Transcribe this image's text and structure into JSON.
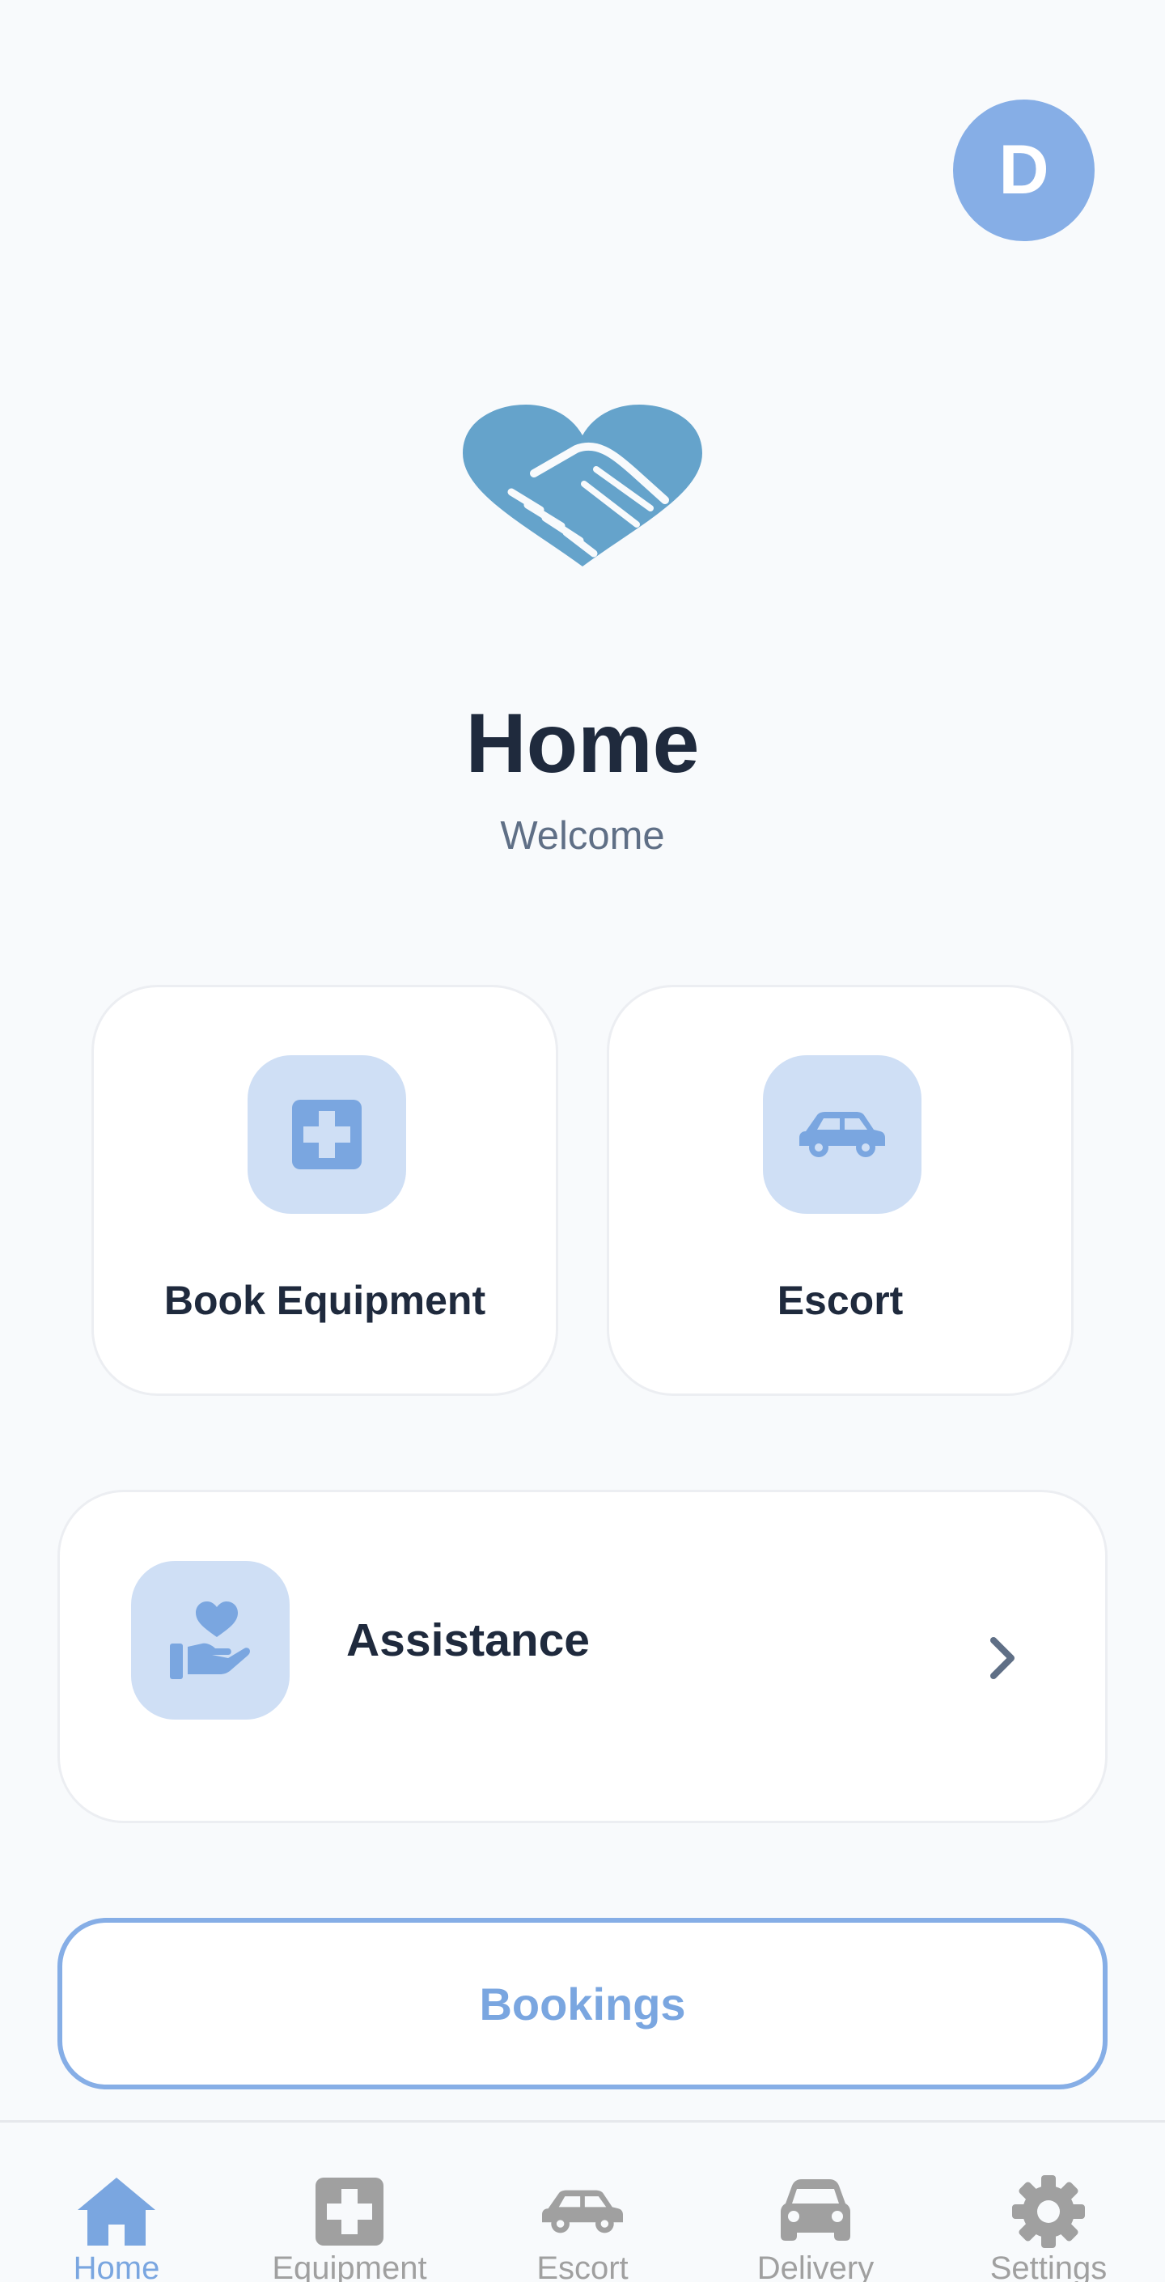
{
  "header": {
    "avatar_initial": "D"
  },
  "hero": {
    "logo_icon": "handshake-heart-icon",
    "title": "Home",
    "subtitle": "Welcome"
  },
  "tiles": [
    {
      "label": "Book Equipment",
      "icon": "medical-cross-icon"
    },
    {
      "label": "Escort",
      "icon": "car-icon"
    }
  ],
  "assistance": {
    "label": "Assistance",
    "icon": "hand-heart-icon"
  },
  "bookings_button": {
    "label": "Bookings"
  },
  "bottom_nav": {
    "items": [
      {
        "label": "Home",
        "icon": "home-icon",
        "active": true
      },
      {
        "label": "Equipment",
        "icon": "medical-cross-icon",
        "active": false
      },
      {
        "label": "Escort",
        "icon": "car-icon",
        "active": false
      },
      {
        "label": "Delivery",
        "icon": "delivery-car-icon",
        "active": false
      },
      {
        "label": "Settings",
        "icon": "gear-icon",
        "active": false
      }
    ]
  },
  "colors": {
    "accent": "#86aee6",
    "accent_text": "#7aa6e0",
    "icon_tint_bg": "#cfdff5",
    "logo": "#65a3cb",
    "title": "#1f2a3d",
    "subtitle": "#5f6f86",
    "nav_inactive": "#a0a0a0",
    "background": "#f8fafc"
  }
}
